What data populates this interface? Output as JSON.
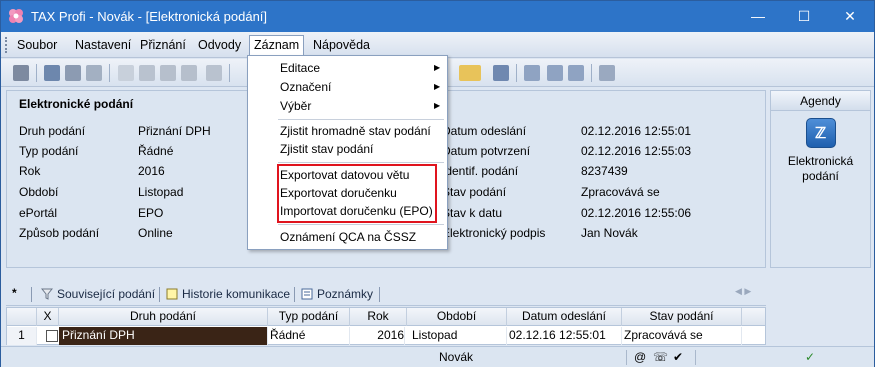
{
  "window": {
    "title": "TAX Profi - Novák - [Elektronická podání]",
    "controls": {
      "minimize": "—",
      "maximize": "☐",
      "close": "✕"
    }
  },
  "menubar": {
    "items": [
      "Soubor",
      "Nastavení",
      "Přiznání",
      "Odvody",
      "Záznam",
      "Nápověda"
    ],
    "active": "Záznam"
  },
  "dropdown": {
    "items": [
      {
        "label": "Editace"
      },
      {
        "label": "Označení"
      },
      {
        "label": "Výběr"
      },
      {
        "label": "Zjistit hromadně stav podání"
      },
      {
        "label": "Zjistit stav podání"
      },
      {
        "label": "Exportovat datovou větu"
      },
      {
        "label": "Exportovat doručenku"
      },
      {
        "label": "Importovat doručenku (EPO)"
      },
      {
        "label": "Oznámení QCA na ČSSZ"
      }
    ],
    "submenu_arrow": "▶"
  },
  "panel": {
    "title": "Elektronické podání",
    "left_labels": [
      "Druh podání",
      "Typ podání",
      "Rok",
      "Období",
      "ePortál",
      "Způsob podání"
    ],
    "left_values": [
      "Přiznání DPH",
      "Řádné",
      "2016",
      "Listopad",
      "EPO",
      "Online"
    ],
    "right_labels": [
      "Datum odeslání",
      "Datum potvrzení",
      "Identif. podání",
      "Stav podání",
      "Stav k datu",
      "Elektronický podpis"
    ],
    "right_values": [
      "02.12.2016 12:55:01",
      "02.12.2016 12:55:03",
      "8237439",
      "Zpracovává se",
      "02.12.2016 12:55:06",
      "Jan Novák"
    ]
  },
  "agendy": {
    "header": "Agendy",
    "item_label": "Elektronická podání",
    "item_icon": "ℤ"
  },
  "tabs": {
    "star": "*",
    "items": [
      "Související podání",
      "Historie komunikace",
      "Poznámky"
    ],
    "arrows": "◀ ▶"
  },
  "grid": {
    "columns": [
      "",
      "X",
      "Druh podání",
      "Typ podání",
      "Rok",
      "Období",
      "Datum odeslání",
      "Stav podání"
    ],
    "rows": [
      {
        "num": "1",
        "druh": "Přiznání DPH",
        "typ": "Řádné",
        "rok": "2016",
        "obdobi": "Listopad",
        "datum": "02.12.16 12:55:01",
        "stav": "Zpracovává se"
      }
    ]
  },
  "statusbar": {
    "user": "Novák",
    "icons": [
      "@",
      "☏",
      "✔",
      "✓"
    ]
  },
  "colors": {
    "titlebar": "#2d74c8",
    "highlight": "#e0141e",
    "selected_cell": "#3a2416"
  }
}
